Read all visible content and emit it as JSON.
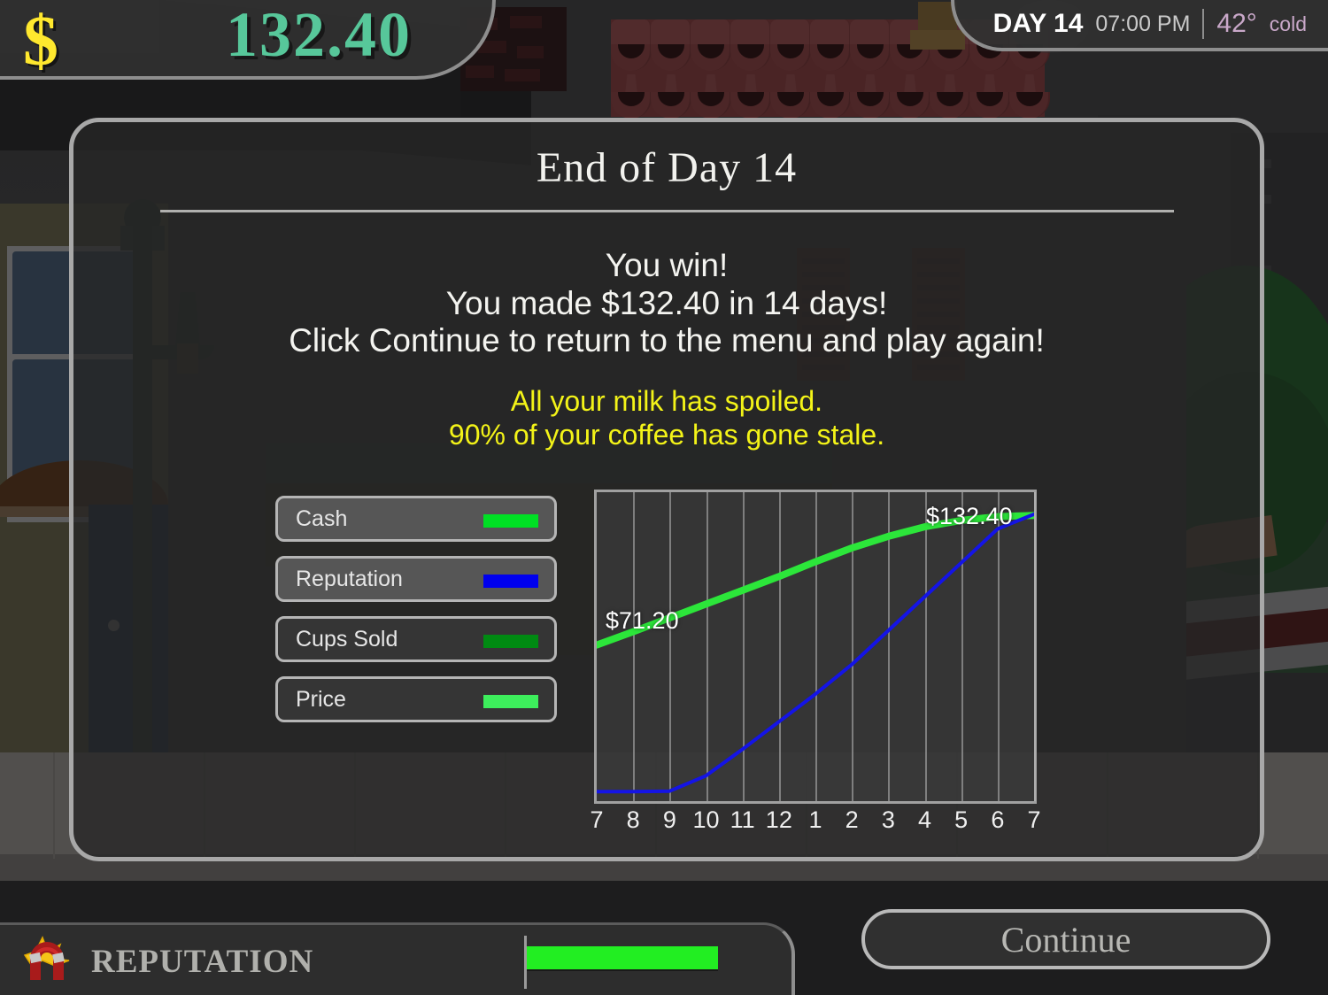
{
  "hud": {
    "money_icon": "dollar-sign-icon",
    "money_amount": "132.40",
    "day_label": "DAY 14",
    "day_time": "07:00 PM",
    "temperature": "42°",
    "temperature_word": "cold"
  },
  "dialog": {
    "title": "End of Day 14",
    "body_lines": [
      "You win!",
      "You made $132.40 in 14 days!",
      "Click Continue to return to the menu and play again!"
    ],
    "warnings": [
      "All your milk has spoiled.",
      "90% of your coffee has gone stale."
    ]
  },
  "legend": {
    "items": [
      {
        "label": "Cash",
        "color": "#00e024",
        "active": true
      },
      {
        "label": "Reputation",
        "color": "#0000ee",
        "active": true
      },
      {
        "label": "Cups Sold",
        "color": "#008a12",
        "active": false
      },
      {
        "label": "Price",
        "color": "#3dee5c",
        "active": false
      }
    ]
  },
  "chart_data": {
    "type": "line",
    "title": "",
    "xlabel": "",
    "ylabel": "",
    "grid": true,
    "legend_position": "left-panel",
    "x": [
      7,
      8,
      9,
      10,
      11,
      12,
      1,
      2,
      3,
      4,
      5,
      6,
      7
    ],
    "xtick_labels": [
      "7",
      "8",
      "9",
      "10",
      "11",
      "12",
      "1",
      "2",
      "3",
      "4",
      "5",
      "6",
      "7"
    ],
    "ylim": [
      0,
      140
    ],
    "series": [
      {
        "name": "Cash",
        "color": "#2ce63a",
        "values": [
          71.2,
          77.5,
          84.0,
          90.5,
          97.0,
          103.5,
          110.5,
          117.0,
          122.5,
          127.0,
          130.0,
          131.8,
          132.4
        ],
        "start_label": "$71.20",
        "end_label": "$132.40"
      },
      {
        "name": "Reputation",
        "color": "#1414e6",
        "values": [
          2.0,
          2.0,
          2.2,
          9.5,
          22.0,
          35.0,
          48.0,
          62.0,
          78.0,
          94.0,
          110.0,
          126.0,
          133.0
        ]
      }
    ]
  },
  "bottom": {
    "reputation_icon": "magnet-icon",
    "reputation_label": "REPUTATION",
    "reputation_percent": 72,
    "reputation_fill_color": "#22ee22",
    "continue_label": "Continue"
  }
}
